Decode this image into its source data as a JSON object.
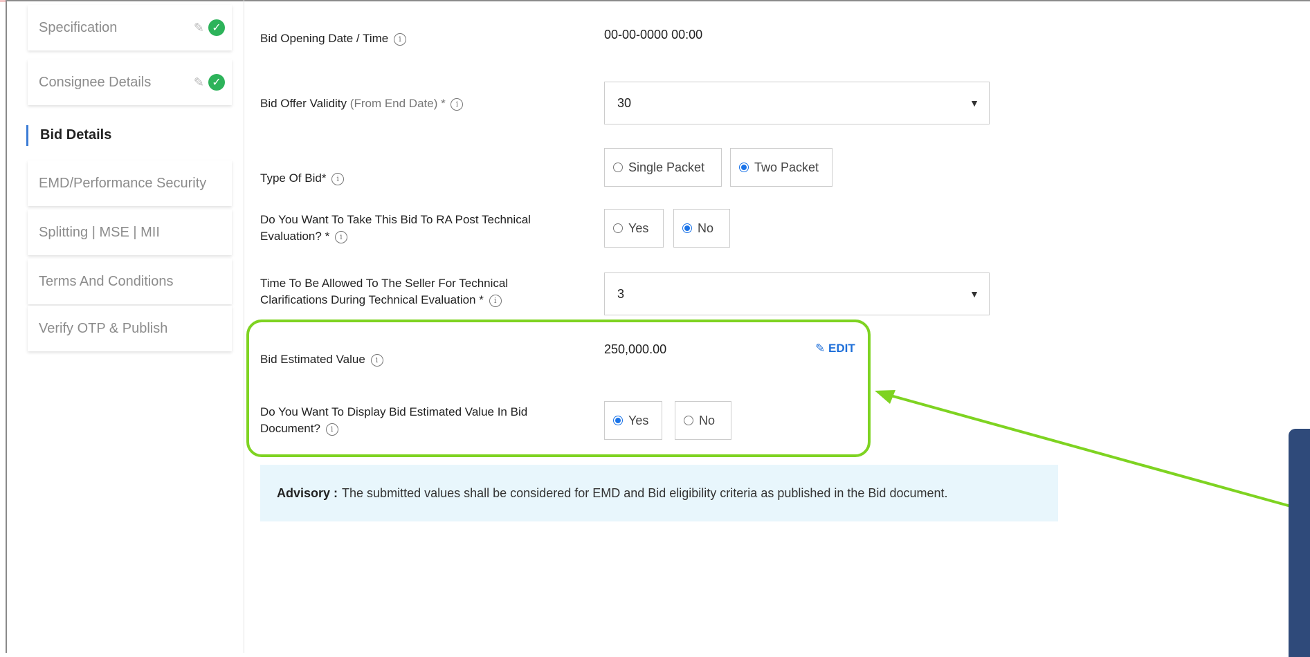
{
  "sidebar": {
    "items": [
      {
        "label": "Specification",
        "state": "complete"
      },
      {
        "label": "Consignee Details",
        "state": "complete"
      },
      {
        "label": "Bid Details",
        "state": "active"
      },
      {
        "label": "EMD/Performance Security",
        "state": "default"
      },
      {
        "label": "Splitting | MSE | MII",
        "state": "default"
      },
      {
        "label": "Terms And Conditions",
        "state": "default"
      },
      {
        "label": "Verify OTP & Publish",
        "state": "default"
      }
    ]
  },
  "form": {
    "bid_opening": {
      "label": "Bid Opening Date / Time",
      "value": "00-00-0000 00:00"
    },
    "offer_validity": {
      "label": "Bid Offer Validity",
      "label_suffix": "(From End Date) *",
      "value": "30"
    },
    "type_of_bid": {
      "label": "Type Of Bid*",
      "options": [
        "Single Packet",
        "Two Packet"
      ],
      "selected": "Two Packet"
    },
    "ra_post_tech": {
      "label_line1": "Do You Want To Take This Bid To RA Post Technical",
      "label_line2": "Evaluation? *",
      "options": [
        "Yes",
        "No"
      ],
      "selected": "No"
    },
    "tech_clarification": {
      "label_line1": "Time To Be Allowed To The Seller For Technical",
      "label_line2": "Clarifications During Technical Evaluation *",
      "value": "3"
    },
    "estimated_value": {
      "label": "Bid Estimated Value",
      "value": "250,000.00",
      "edit_label": "EDIT"
    },
    "display_estimate": {
      "label_line1": "Do You Want To Display Bid Estimated Value In Bid",
      "label_line2": "Document?",
      "options": [
        "Yes",
        "No"
      ],
      "selected": "Yes"
    }
  },
  "advisory": {
    "title": "Advisory :",
    "text": "The submitted values shall be considered for EMD and Bid eligibility criteria as published in the Bid document."
  },
  "icons": {
    "info": "info-icon",
    "edit": "pencil-icon",
    "done": "check-circle-icon",
    "select": "chevron-down-icon"
  },
  "colors": {
    "accent": "#3a7bd5",
    "highlight": "#7ed321",
    "advisory_bg": "#e8f6fc",
    "success": "#2db35a",
    "edit": "#1e6fd9"
  }
}
